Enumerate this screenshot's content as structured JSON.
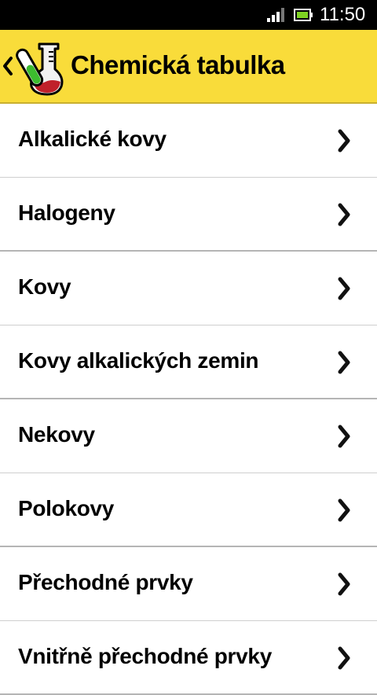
{
  "status_bar": {
    "time": "11:50",
    "signal_icon": "signal-icon",
    "battery_icon": "battery-icon"
  },
  "app_bar": {
    "title": "Chemická tabulka",
    "back_icon": "back-chevron-icon",
    "logo_icon": "flask-test-tube-icon",
    "background_color": "#f9dc3a"
  },
  "list": {
    "items": [
      {
        "label": "Alkalické kovy"
      },
      {
        "label": "Halogeny"
      },
      {
        "label": "Kovy"
      },
      {
        "label": "Kovy alkalických zemin"
      },
      {
        "label": "Nekovy"
      },
      {
        "label": "Polokovy"
      },
      {
        "label": "Přechodné prvky"
      },
      {
        "label": "Vnitřně přechodné prvky"
      }
    ],
    "chevron_icon": "chevron-right-icon"
  }
}
